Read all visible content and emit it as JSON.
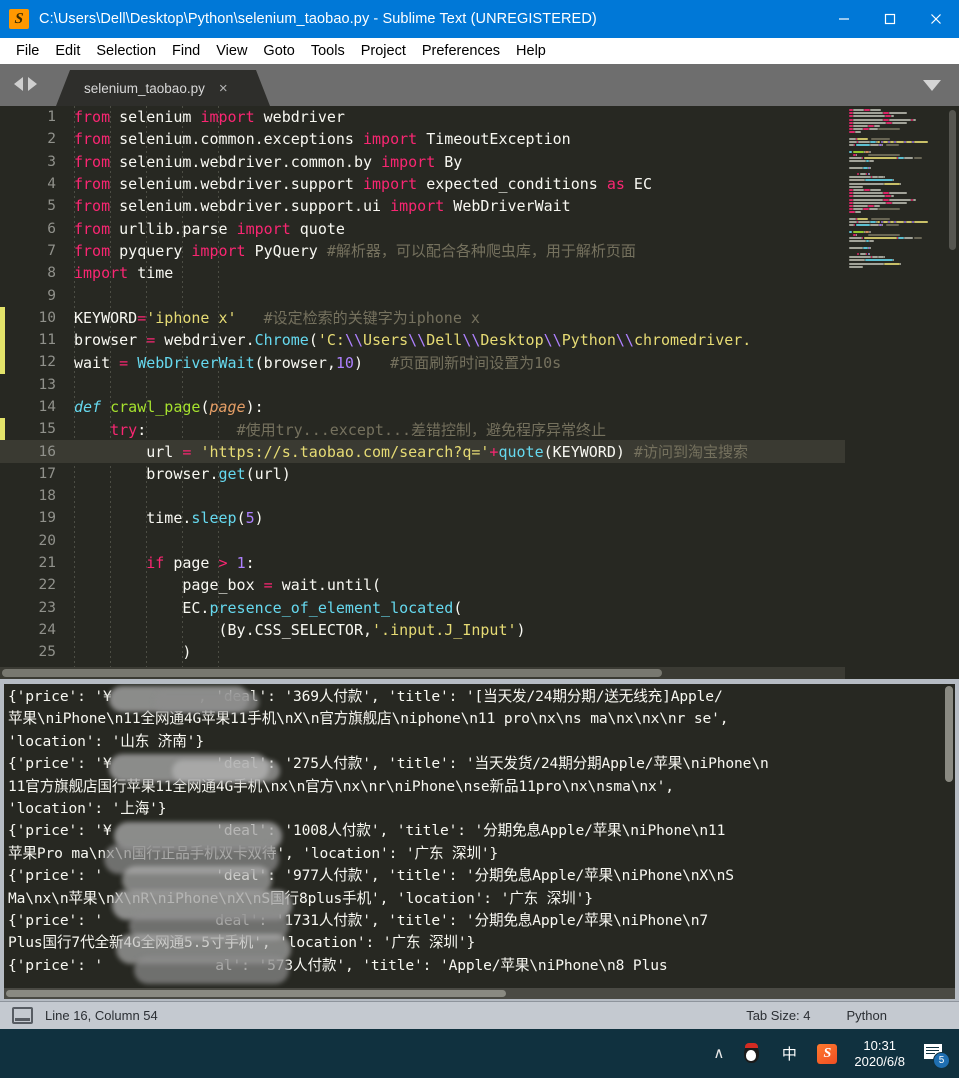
{
  "window": {
    "title": "C:\\Users\\Dell\\Desktop\\Python\\selenium_taobao.py - Sublime Text (UNREGISTERED)",
    "logo_label": "S",
    "minimize_label": "Minimize",
    "maximize_label": "Maximize",
    "close_label": "Close",
    "titlebar_color": "#0078d7"
  },
  "menubar": {
    "items": [
      {
        "label": "File"
      },
      {
        "label": "Edit"
      },
      {
        "label": "Selection"
      },
      {
        "label": "Find"
      },
      {
        "label": "View"
      },
      {
        "label": "Goto"
      },
      {
        "label": "Tools"
      },
      {
        "label": "Project"
      },
      {
        "label": "Preferences"
      },
      {
        "label": "Help"
      }
    ]
  },
  "tabbar": {
    "active_tab": "selenium_taobao.py",
    "close_glyph": "×"
  },
  "editor": {
    "theme_background": "#272822",
    "current_line": 16,
    "lines": [
      {
        "n": 1,
        "tokens": [
          {
            "t": "from",
            "c": "kw"
          },
          {
            "t": " selenium ",
            "c": "plain"
          },
          {
            "t": "import",
            "c": "kw"
          },
          {
            "t": " webdriver",
            "c": "plain"
          }
        ]
      },
      {
        "n": 2,
        "tokens": [
          {
            "t": "from",
            "c": "kw"
          },
          {
            "t": " selenium.common.exceptions ",
            "c": "plain"
          },
          {
            "t": "import",
            "c": "kw"
          },
          {
            "t": " TimeoutException",
            "c": "plain"
          }
        ]
      },
      {
        "n": 3,
        "tokens": [
          {
            "t": "from",
            "c": "kw"
          },
          {
            "t": " selenium.webdriver.common.by ",
            "c": "plain"
          },
          {
            "t": "import",
            "c": "kw"
          },
          {
            "t": " By",
            "c": "plain"
          }
        ]
      },
      {
        "n": 4,
        "tokens": [
          {
            "t": "from",
            "c": "kw"
          },
          {
            "t": " selenium.webdriver.support ",
            "c": "plain"
          },
          {
            "t": "import",
            "c": "kw"
          },
          {
            "t": " expected_conditions ",
            "c": "plain"
          },
          {
            "t": "as",
            "c": "kw"
          },
          {
            "t": " EC",
            "c": "plain"
          }
        ]
      },
      {
        "n": 5,
        "tokens": [
          {
            "t": "from",
            "c": "kw"
          },
          {
            "t": " selenium.webdriver.support.ui ",
            "c": "plain"
          },
          {
            "t": "import",
            "c": "kw"
          },
          {
            "t": " WebDriverWait",
            "c": "plain"
          }
        ]
      },
      {
        "n": 6,
        "tokens": [
          {
            "t": "from",
            "c": "kw"
          },
          {
            "t": " urllib.parse ",
            "c": "plain"
          },
          {
            "t": "import",
            "c": "kw"
          },
          {
            "t": " quote",
            "c": "plain"
          }
        ]
      },
      {
        "n": 7,
        "tokens": [
          {
            "t": "from",
            "c": "kw"
          },
          {
            "t": " pyquery ",
            "c": "plain"
          },
          {
            "t": "import",
            "c": "kw"
          },
          {
            "t": " PyQuery ",
            "c": "plain"
          },
          {
            "t": "#解析器，可以配合各种爬虫库，用于解析页面",
            "c": "com"
          }
        ]
      },
      {
        "n": 8,
        "tokens": [
          {
            "t": "import",
            "c": "kw"
          },
          {
            "t": " time",
            "c": "plain"
          }
        ]
      },
      {
        "n": 9,
        "tokens": []
      },
      {
        "n": 10,
        "tokens": [
          {
            "t": "KEYWORD",
            "c": "plain"
          },
          {
            "t": "=",
            "c": "op"
          },
          {
            "t": "'iphone x'",
            "c": "str"
          },
          {
            "t": "   ",
            "c": "plain"
          },
          {
            "t": "#设定检索的关键字为iphone x",
            "c": "com"
          }
        ]
      },
      {
        "n": 11,
        "tokens": [
          {
            "t": "browser ",
            "c": "plain"
          },
          {
            "t": "=",
            "c": "op"
          },
          {
            "t": " webdriver.",
            "c": "plain"
          },
          {
            "t": "Chrome",
            "c": "cls"
          },
          {
            "t": "(",
            "c": "plain"
          },
          {
            "t": "'C:",
            "c": "str"
          },
          {
            "t": "\\\\",
            "c": "esc"
          },
          {
            "t": "Users",
            "c": "str"
          },
          {
            "t": "\\\\",
            "c": "esc"
          },
          {
            "t": "Dell",
            "c": "str"
          },
          {
            "t": "\\\\",
            "c": "esc"
          },
          {
            "t": "Desktop",
            "c": "str"
          },
          {
            "t": "\\\\",
            "c": "esc"
          },
          {
            "t": "Python",
            "c": "str"
          },
          {
            "t": "\\\\",
            "c": "esc"
          },
          {
            "t": "chromedriver.",
            "c": "str"
          }
        ]
      },
      {
        "n": 12,
        "tokens": [
          {
            "t": "wait ",
            "c": "plain"
          },
          {
            "t": "=",
            "c": "op"
          },
          {
            "t": " ",
            "c": "plain"
          },
          {
            "t": "WebDriverWait",
            "c": "cls"
          },
          {
            "t": "(browser,",
            "c": "plain"
          },
          {
            "t": "10",
            "c": "num"
          },
          {
            "t": ")",
            "c": "plain"
          },
          {
            "t": "   ",
            "c": "plain"
          },
          {
            "t": "#页面刷新时间设置为10s",
            "c": "com"
          }
        ]
      },
      {
        "n": 13,
        "tokens": []
      },
      {
        "n": 14,
        "tokens": [
          {
            "t": "def",
            "c": "def"
          },
          {
            "t": " ",
            "c": "plain"
          },
          {
            "t": "crawl_page",
            "c": "fn"
          },
          {
            "t": "(",
            "c": "plain"
          },
          {
            "t": "page",
            "c": "par"
          },
          {
            "t": "):",
            "c": "plain"
          }
        ]
      },
      {
        "n": 15,
        "tokens": [
          {
            "t": "    ",
            "c": "plain"
          },
          {
            "t": "try",
            "c": "kw"
          },
          {
            "t": ":",
            "c": "plain"
          },
          {
            "t": "          ",
            "c": "plain"
          },
          {
            "t": "#使用try...except...差错控制，避免程序异常终止",
            "c": "com"
          }
        ]
      },
      {
        "n": 16,
        "tokens": [
          {
            "t": "        url ",
            "c": "plain"
          },
          {
            "t": "=",
            "c": "op"
          },
          {
            "t": " ",
            "c": "plain"
          },
          {
            "t": "'https://s.taobao.com/search?q='",
            "c": "str"
          },
          {
            "t": "+",
            "c": "op"
          },
          {
            "t": "quote",
            "c": "cls"
          },
          {
            "t": "(KEYWORD)",
            "c": "plain"
          },
          {
            "t": " ",
            "c": "plain"
          },
          {
            "t": "#访问到淘宝搜索",
            "c": "com"
          }
        ]
      },
      {
        "n": 17,
        "tokens": [
          {
            "t": "        browser.",
            "c": "plain"
          },
          {
            "t": "get",
            "c": "cls"
          },
          {
            "t": "(url)",
            "c": "plain"
          }
        ]
      },
      {
        "n": 18,
        "tokens": []
      },
      {
        "n": 19,
        "tokens": [
          {
            "t": "        time.",
            "c": "plain"
          },
          {
            "t": "sleep",
            "c": "cls"
          },
          {
            "t": "(",
            "c": "plain"
          },
          {
            "t": "5",
            "c": "num"
          },
          {
            "t": ")",
            "c": "plain"
          }
        ]
      },
      {
        "n": 20,
        "tokens": []
      },
      {
        "n": 21,
        "tokens": [
          {
            "t": "        ",
            "c": "plain"
          },
          {
            "t": "if",
            "c": "kw"
          },
          {
            "t": " page ",
            "c": "plain"
          },
          {
            "t": ">",
            "c": "op"
          },
          {
            "t": " ",
            "c": "plain"
          },
          {
            "t": "1",
            "c": "num"
          },
          {
            "t": ":",
            "c": "plain"
          }
        ]
      },
      {
        "n": 22,
        "tokens": [
          {
            "t": "            page_box ",
            "c": "plain"
          },
          {
            "t": "=",
            "c": "op"
          },
          {
            "t": " wait.",
            "c": "plain"
          },
          {
            "t": "until",
            "c": "plain"
          },
          {
            "t": "(",
            "c": "plain"
          }
        ]
      },
      {
        "n": 23,
        "tokens": [
          {
            "t": "            EC.",
            "c": "plain"
          },
          {
            "t": "presence_of_element_located",
            "c": "cls"
          },
          {
            "t": "(",
            "c": "plain"
          }
        ]
      },
      {
        "n": 24,
        "tokens": [
          {
            "t": "                (By.CSS_SELECTOR,",
            "c": "plain"
          },
          {
            "t": "'.input.J_Input'",
            "c": "str"
          },
          {
            "t": ")",
            "c": "plain"
          }
        ]
      },
      {
        "n": 25,
        "tokens": [
          {
            "t": "            )",
            "c": "plain"
          }
        ]
      }
    ],
    "modified_marker_lines": [
      10,
      11,
      12,
      15,
      16
    ]
  },
  "console": {
    "lines": [
      "{'price': '¥          , 'deal': '369人付款', 'title': '[当天发/24期分期/送无线充]Apple/",
      "苹果\\niPhone\\n11全网通4G苹果11手机\\nX\\n官方旗舰店\\niphone\\n11 pro\\nx\\ns ma\\nx\\nx\\nr se',",
      "'location': '山东 济南'}",
      "{'price': '¥            'deal': '275人付款', 'title': '当天发货/24期分期Apple/苹果\\niPhone\\n",
      "11官方旗舰店国行苹果11全网通4G手机\\nx\\n官方\\nx\\nr\\niPhone\\nse新品11pro\\nx\\nsma\\nx',",
      "'location': '上海'}",
      "{'price': '¥            'deal': '1008人付款', 'title': '分期免息Apple/苹果\\niPhone\\n11",
      "苹果Pro ma\\nx\\n国行正品手机双卡双待', 'location': '广东 深圳'}",
      "{'price': '             'deal': '977人付款', 'title': '分期免息Apple/苹果\\niPhone\\nX\\nS",
      "Ma\\nx\\n苹果\\nX\\nR\\niPhone\\nX\\nS国行8plus手机', 'location': '广东 深圳'}",
      "{'price': '             deal': '1731人付款', 'title': '分期免息Apple/苹果\\niPhone\\n7",
      "Plus国行7代全新4G全网通5.5寸手机', 'location': '广东 深圳'}",
      "{'price': '             al': '573人付款', 'title': 'Apple/苹果\\niPhone\\n8 Plus"
    ]
  },
  "statusbar": {
    "cursor": "Line 16, Column 54",
    "tab_size": "Tab Size: 4",
    "syntax": "Python"
  },
  "taskbar": {
    "tray_chevron": "∧",
    "ime_label": "中",
    "sogou_label": "S",
    "time": "10:31",
    "date": "2020/6/8",
    "notification_count": "5"
  }
}
